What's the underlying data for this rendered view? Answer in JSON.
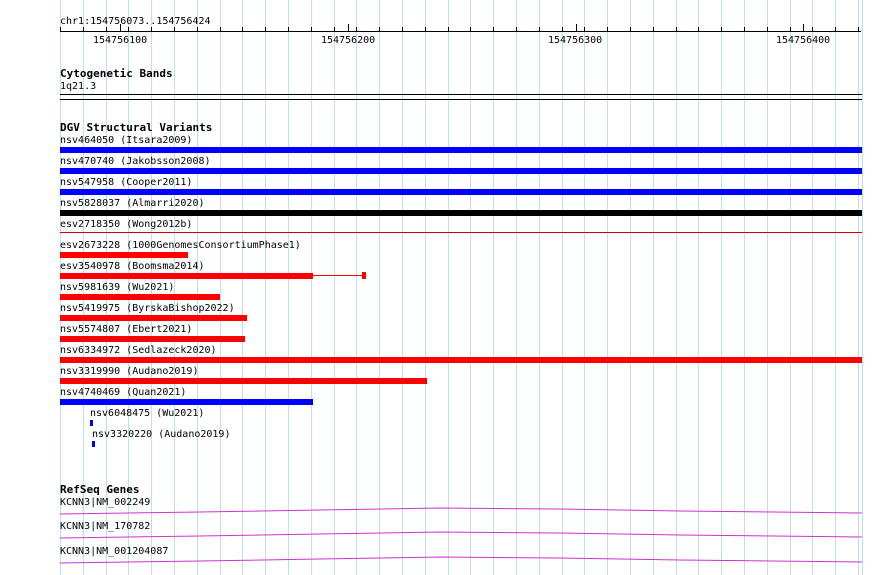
{
  "ruler": {
    "range_label": "chr1:154756073..154756424",
    "ticks": [
      "154756100",
      "154756200",
      "154756300",
      "154756400"
    ]
  },
  "cytoband": {
    "title": "Cytogenetic Bands",
    "band": "1q21.3"
  },
  "dgv": {
    "title": "DGV Structural Variants",
    "items": [
      {
        "label": "nsv464050 (Itsara2009)",
        "color": "#0000ff",
        "kind": "bar"
      },
      {
        "label": "nsv470740 (Jakobsson2008)",
        "color": "#0000ff",
        "kind": "bar"
      },
      {
        "label": "nsv547958 (Cooper2011)",
        "color": "#0000ff",
        "kind": "bar"
      },
      {
        "label": "nsv5828037 (Almarri2020)",
        "color": "#000000",
        "kind": "bar"
      },
      {
        "label": "esv2718350 (Wong2012b)",
        "color": "#cc0000",
        "kind": "line"
      },
      {
        "label": "esv2673228 (1000GenomesConsortiumPhase1)",
        "color": "#ff0000",
        "kind": "bar"
      },
      {
        "label": "esv3540978 (Boomsma2014)",
        "color": "#ff0000",
        "kind": "split"
      },
      {
        "label": "nsv5981639 (Wu2021)",
        "color": "#ff0000",
        "kind": "bar"
      },
      {
        "label": "nsv5419975 (ByrskaBishop2022)",
        "color": "#ff0000",
        "kind": "bar"
      },
      {
        "label": "nsv5574807 (Ebert2021)",
        "color": "#ff0000",
        "kind": "bar"
      },
      {
        "label": "nsv6334972 (Sedlazeck2020)",
        "color": "#ff0000",
        "kind": "bar"
      },
      {
        "label": "nsv3319990 (Audano2019)",
        "color": "#ff0000",
        "kind": "bar"
      },
      {
        "label": "nsv4740469 (Quan2021)",
        "color": "#0000ff",
        "kind": "bar"
      },
      {
        "label": "nsv6048475 (Wu2021)",
        "color": "#0000ff",
        "kind": "bar"
      },
      {
        "label": "nsv3320220 (Audano2019)",
        "color": "#0000ff",
        "kind": "bar"
      }
    ]
  },
  "refseq": {
    "title": "RefSeq Genes",
    "color": "#cc33cc",
    "genes": [
      {
        "label": "KCNN3|NM_002249"
      },
      {
        "label": "KCNN3|NM_170782"
      },
      {
        "label": "KCNN3|NM_001204087"
      }
    ]
  }
}
